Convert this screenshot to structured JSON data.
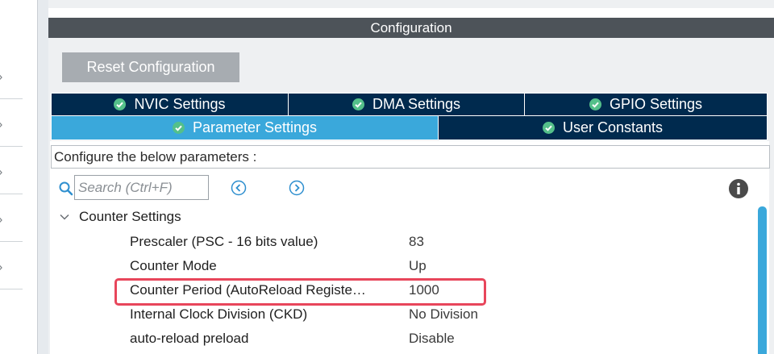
{
  "header": {
    "title": "Configuration"
  },
  "toolbar": {
    "reset_label": "Reset Configuration"
  },
  "tabs": [
    {
      "label": "NVIC Settings",
      "icon": "check-circle-icon"
    },
    {
      "label": "DMA Settings",
      "icon": "check-circle-icon"
    },
    {
      "label": "GPIO Settings",
      "icon": "check-circle-icon"
    },
    {
      "label": "Parameter Settings",
      "icon": "check-circle-icon",
      "active": true
    },
    {
      "label": "User Constants",
      "icon": "check-circle-icon"
    }
  ],
  "configure_text": "Configure the below parameters :",
  "search": {
    "placeholder": "Search (Ctrl+F)"
  },
  "group": {
    "label": "Counter Settings"
  },
  "params": [
    {
      "name": "Prescaler (PSC - 16 bits value)",
      "value": "83"
    },
    {
      "name": "Counter Mode",
      "value": "Up"
    },
    {
      "name": "Counter Period (AutoReload Registe…",
      "value": "1000"
    },
    {
      "name": "Internal Clock Division (CKD)",
      "value": "No Division"
    },
    {
      "name": "auto-reload preload",
      "value": "Disable"
    }
  ],
  "colors": {
    "tab_dark": "#002a4e",
    "tab_active": "#3aa8db",
    "check": "#54c08a",
    "highlight": "#e8465b",
    "header": "#4d5359"
  }
}
